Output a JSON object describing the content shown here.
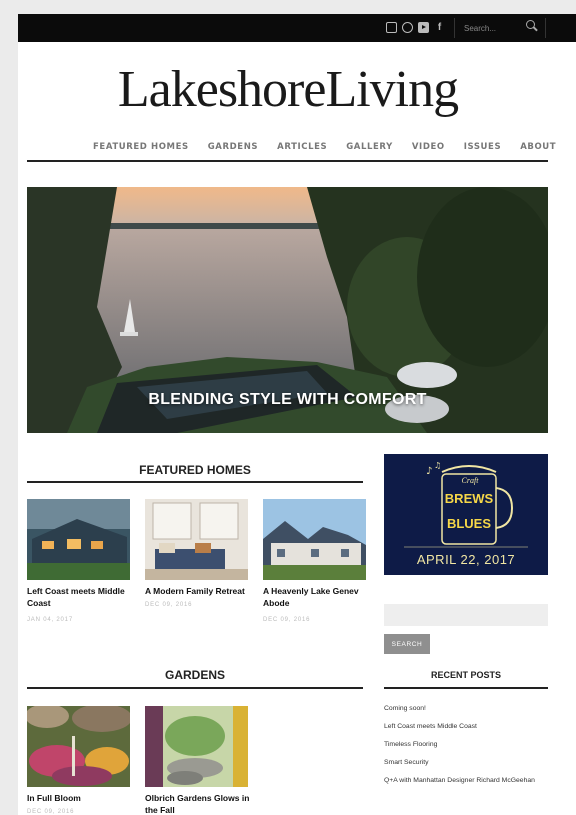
{
  "header": {
    "search_placeholder": "Search...",
    "social_icons": [
      "instagram-icon",
      "pinterest-icon",
      "youtube-icon",
      "facebook-icon"
    ]
  },
  "logo": {
    "text": "LakeshoreLiving"
  },
  "nav": {
    "items": [
      "FEATURED HOMES",
      "GARDENS",
      "ARTICLES",
      "GALLERY",
      "VIDEO",
      "ISSUES",
      "ABOUT"
    ]
  },
  "hero": {
    "title": "BLENDING STYLE WITH COMFORT"
  },
  "featured": {
    "heading": "FEATURED HOMES",
    "cards": [
      {
        "title": "Left Coast meets Middle Coast",
        "date": "JAN 04, 2017"
      },
      {
        "title": "A Modern Family Retreat",
        "date": "DEC 09, 2016"
      },
      {
        "title": "A Heavenly Lake Genev Abode",
        "date": "DEC 09, 2016"
      }
    ]
  },
  "gardens": {
    "heading": "GARDENS",
    "cards": [
      {
        "title": "In Full Bloom",
        "date": "DEC 09, 2016"
      },
      {
        "title": "Olbrich Gardens Glows in the Fall",
        "date": ""
      }
    ]
  },
  "sidebar": {
    "ad": {
      "line1": "Craft",
      "line2": "BREWS",
      "line3": "BLUES",
      "date": "APRIL 22, 2017"
    },
    "search_button": "SEARCH",
    "recent_heading": "RECENT POSTS",
    "recent_posts": [
      "Coming soon!",
      "Left Coast meets Middle Coast",
      "Timeless Flooring",
      "Smart Security",
      "Q+A with Manhattan Designer Richard McGeehan"
    ]
  },
  "colors": {
    "topbar": "#0b0b0b",
    "ad_background": "#0e1b47",
    "ad_text": "#f6d748",
    "button": "#8f8f8f"
  }
}
